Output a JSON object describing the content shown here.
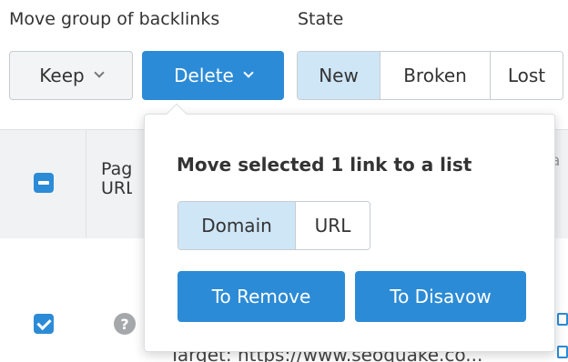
{
  "toolbar": {
    "move_group_label": "Move group of backlinks",
    "keep_label": "Keep",
    "delete_label": "Delete",
    "state_label": "State",
    "state_tabs": [
      {
        "label": "New",
        "active": true
      },
      {
        "label": "Broken",
        "active": false
      },
      {
        "label": "Lost",
        "active": false
      }
    ]
  },
  "table": {
    "header_col2": "Page\nURL",
    "header_right": "a",
    "row1": {
      "target_text": "Target: https://www.seoquake.co..."
    }
  },
  "popover": {
    "title": "Move selected 1 link to a list",
    "scope_tabs": [
      {
        "label": "Domain",
        "active": true
      },
      {
        "label": "URL",
        "active": false
      }
    ],
    "remove_label": "To Remove",
    "disavow_label": "To Disavow"
  },
  "colors": {
    "accent": "#2c8bd6",
    "active_segment": "#cfe6f7",
    "header_bg": "#f0f2f4"
  },
  "icons": [
    "chevron-down-icon",
    "minus-checkbox-icon",
    "checkbox-checked-icon",
    "question-circle-icon",
    "external-link-icon"
  ]
}
